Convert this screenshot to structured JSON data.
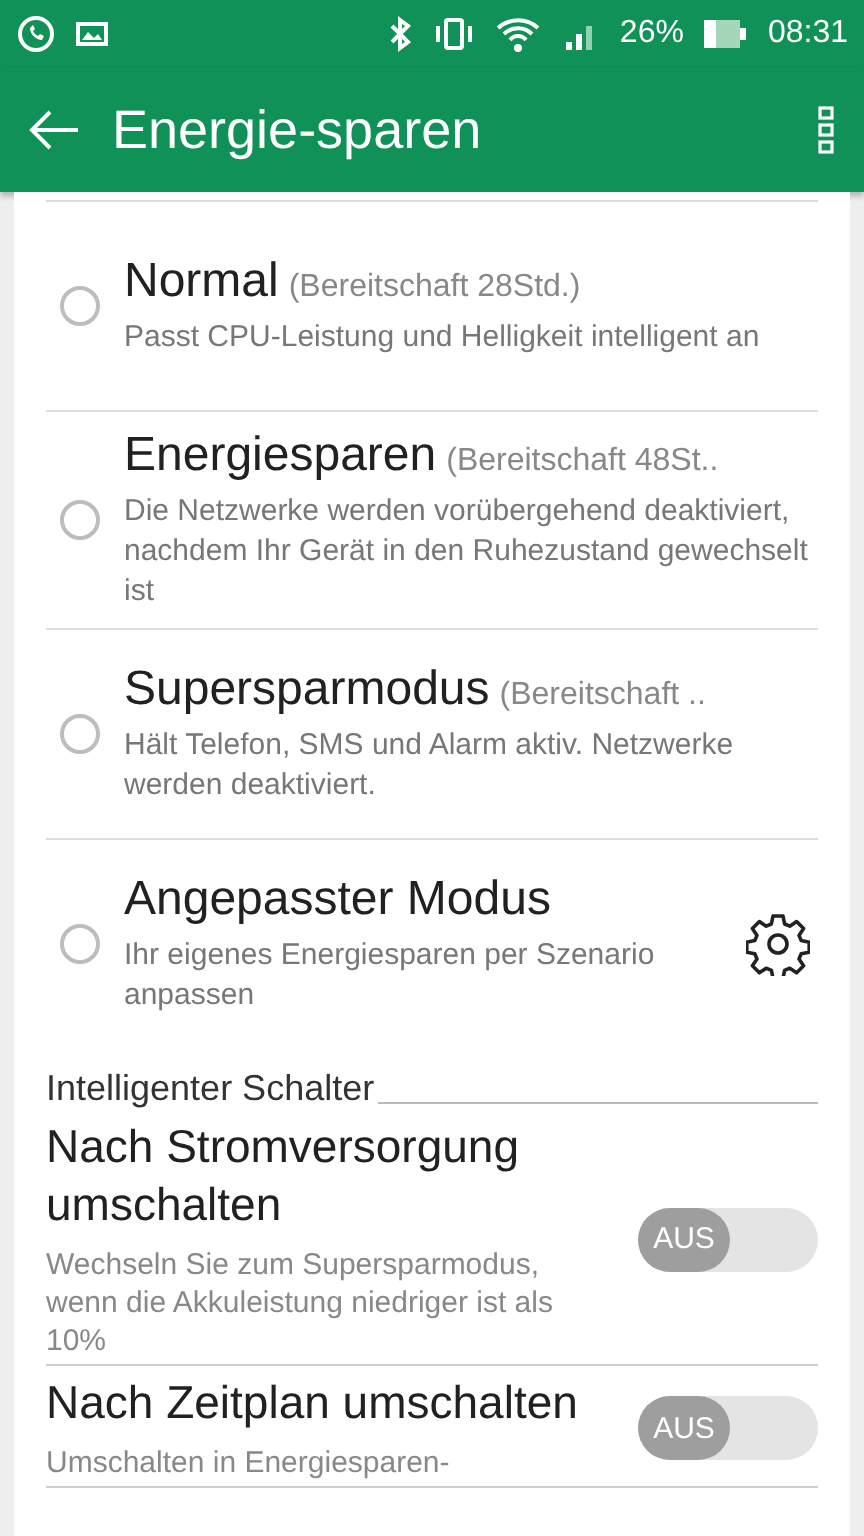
{
  "status_bar": {
    "battery": "26%",
    "time": "08:31"
  },
  "app_bar": {
    "title": "Energie-sparen"
  },
  "modes": [
    {
      "title": "Normal",
      "standby": "(Bereitschaft 28Std.)",
      "description": "Passt CPU-Leistung und Helligkeit intelligent an",
      "selected": false,
      "settings": false
    },
    {
      "title": "Energiesparen",
      "standby": "(Bereitschaft 48St..",
      "description": "Die Netzwerke werden vorübergehend deaktiviert, nachdem Ihr Gerät in den Ruhezustand gewechselt ist",
      "selected": false,
      "settings": false
    },
    {
      "title": "Supersparmodus",
      "standby": "(Bereitschaft ..",
      "description": "Hält Telefon, SMS und Alarm aktiv. Netzwerke werden deaktiviert.",
      "selected": false,
      "settings": false
    },
    {
      "title": "Angepasster Modus",
      "description": "Ihr eigenes Energiesparen per Szenario anpassen",
      "selected": false,
      "settings": true
    }
  ],
  "section": {
    "title": "Intelligenter Schalter"
  },
  "switches": [
    {
      "title": "Nach Stromversorgung umschalten",
      "description": "Wechseln Sie zum Supersparmodus, wenn die Akkuleistung niedriger ist als 10%",
      "label": "AUS",
      "on": false
    },
    {
      "title": "Nach Zeitplan umschalten",
      "description": "Umschalten in Energiesparen-",
      "label": "AUS",
      "on": false
    }
  ]
}
